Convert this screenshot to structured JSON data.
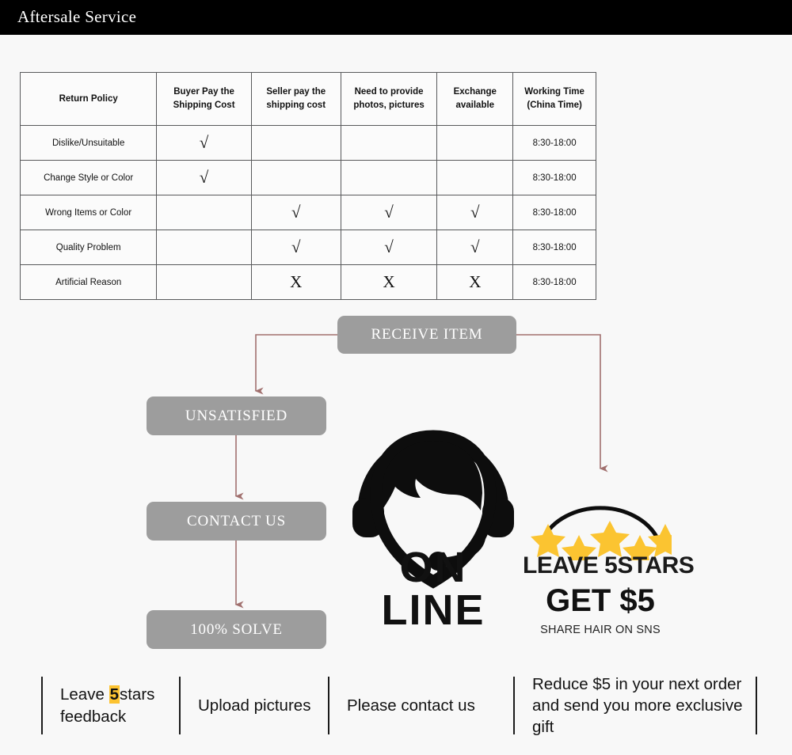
{
  "header": {
    "title": "Aftersale Service",
    "background": "#000000",
    "text_color": "#ffffff"
  },
  "page": {
    "background": "#f8f8f8"
  },
  "table": {
    "columns": [
      "Return Policy",
      "Buyer Pay the Shipping Cost",
      "Seller pay the shipping cost",
      "Need to provide photos, pictures",
      "Exchange available",
      "Working Time (China Time)"
    ],
    "columns_lines": [
      [
        "Return Policy"
      ],
      [
        "Buyer Pay the",
        "Shipping Cost"
      ],
      [
        "Seller pay the",
        "shipping cost"
      ],
      [
        "Need to provide",
        "photos, pictures"
      ],
      [
        "Exchange",
        "available"
      ],
      [
        "Working Time",
        "(China Time)"
      ]
    ],
    "rows": [
      {
        "policy": "Dislike/Unsuitable",
        "buyer_pay": "√",
        "seller_pay": "",
        "photos": "",
        "exchange": "",
        "working_time": "8:30-18:00"
      },
      {
        "policy": "Change Style or Color",
        "buyer_pay": "√",
        "seller_pay": "",
        "photos": "",
        "exchange": "",
        "working_time": "8:30-18:00"
      },
      {
        "policy": "Wrong Items or Color",
        "buyer_pay": "",
        "seller_pay": "√",
        "photos": "√",
        "exchange": "√",
        "working_time": "8:30-18:00"
      },
      {
        "policy": "Quality Problem",
        "buyer_pay": "",
        "seller_pay": "√",
        "photos": "√",
        "exchange": "√",
        "working_time": "8:30-18:00"
      },
      {
        "policy": "Artificial Reason",
        "buyer_pay": "",
        "seller_pay": "X",
        "photos": "X",
        "exchange": "X",
        "working_time": "8:30-18:00"
      }
    ]
  },
  "flow": {
    "box_color": "#9d9d9d",
    "arrow_color": "#a1706e",
    "boxes": {
      "receive": "RECEIVE ITEM",
      "unsatisfied": "UNSATISFIED",
      "contact": "CONTACT US",
      "solve": "100% SOLVE"
    }
  },
  "online": {
    "icon": "headset-operator-icon",
    "label": "ON LINE"
  },
  "badge": {
    "star_color": "#fbc431",
    "star_count": 5,
    "line1": "LEAVE 5STARS",
    "line2": "GET $5",
    "line3": "SHARE HAIR ON SNS"
  },
  "bottom_bar": {
    "highlight_color": "#fcc331",
    "cells": [
      {
        "line1_pre": "Leave ",
        "highlight": "5",
        "line1_post": "stars",
        "line2": "feedback"
      },
      {
        "line1_pre": "Upload pictures",
        "highlight": "",
        "line1_post": "",
        "line2": ""
      },
      {
        "line1_pre": "Please contact us",
        "highlight": "",
        "line1_post": "",
        "line2": ""
      },
      {
        "line1_pre": "Reduce $5 in your next order",
        "highlight": "",
        "line1_post": "",
        "line2": "and send you more exclusive gift"
      }
    ]
  }
}
